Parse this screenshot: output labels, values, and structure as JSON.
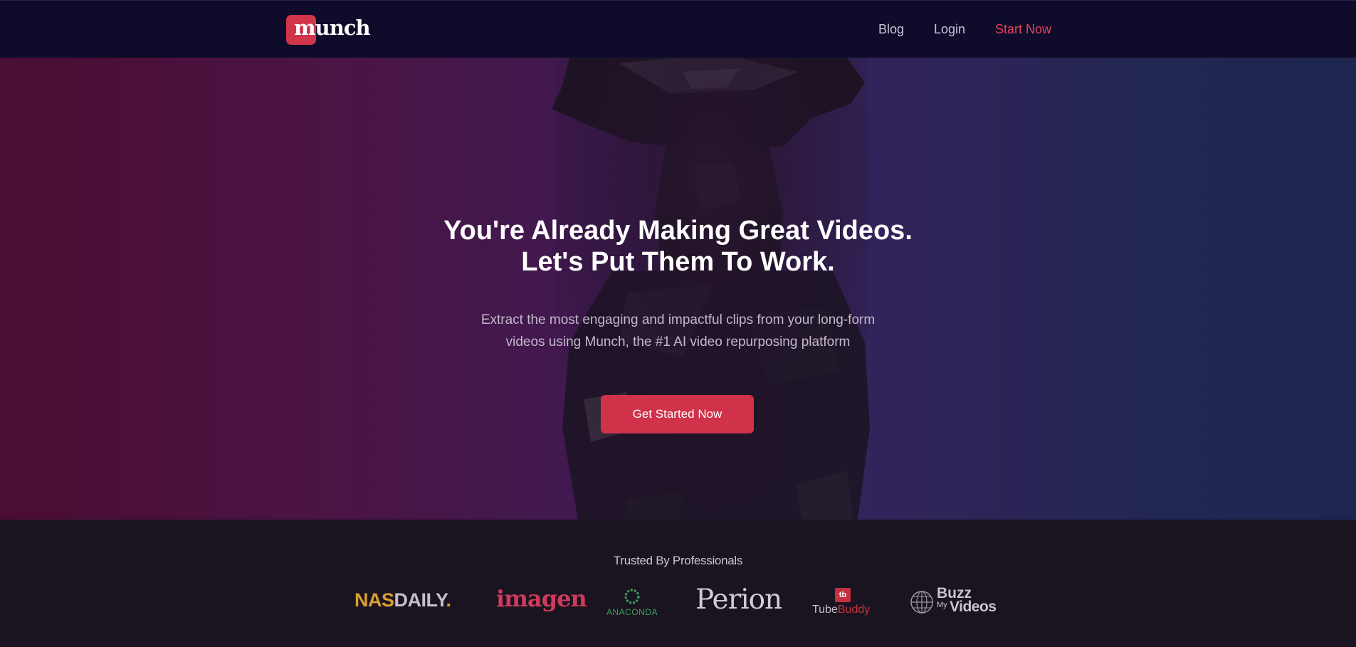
{
  "nav": {
    "logo_text": "munch",
    "links": [
      {
        "label": "Blog"
      },
      {
        "label": "Login"
      },
      {
        "label": "Start Now"
      }
    ]
  },
  "hero": {
    "title_line1": "You're Already Making Great Videos.",
    "title_line2": "Let's Put Them To Work.",
    "subtitle_line1": "Extract the most engaging and impactful clips from your long-form",
    "subtitle_line2": "videos using Munch, the #1 AI video repurposing platform",
    "cta_label": "Get Started Now"
  },
  "trusted": {
    "title": "Trusted By Professionals",
    "brands": {
      "nasdaily_nas": "NAS",
      "nasdaily_daily": "DAILY",
      "nasdaily_dot": ".",
      "imagen": "imagen",
      "anaconda": "ANACONDA",
      "perion": "Perion",
      "tubebuddy_badge": "tb",
      "tubebuddy_tube": "Tube",
      "tubebuddy_buddy": "Buddy",
      "buzz_l1": "Buzz",
      "buzz_l2": "My",
      "buzz_l3": "Videos"
    }
  },
  "colors": {
    "nav_bg": "#0f0b2a",
    "accent": "#cf3249",
    "start_now_link": "#e84257",
    "trusted_bg": "#1a1420"
  }
}
